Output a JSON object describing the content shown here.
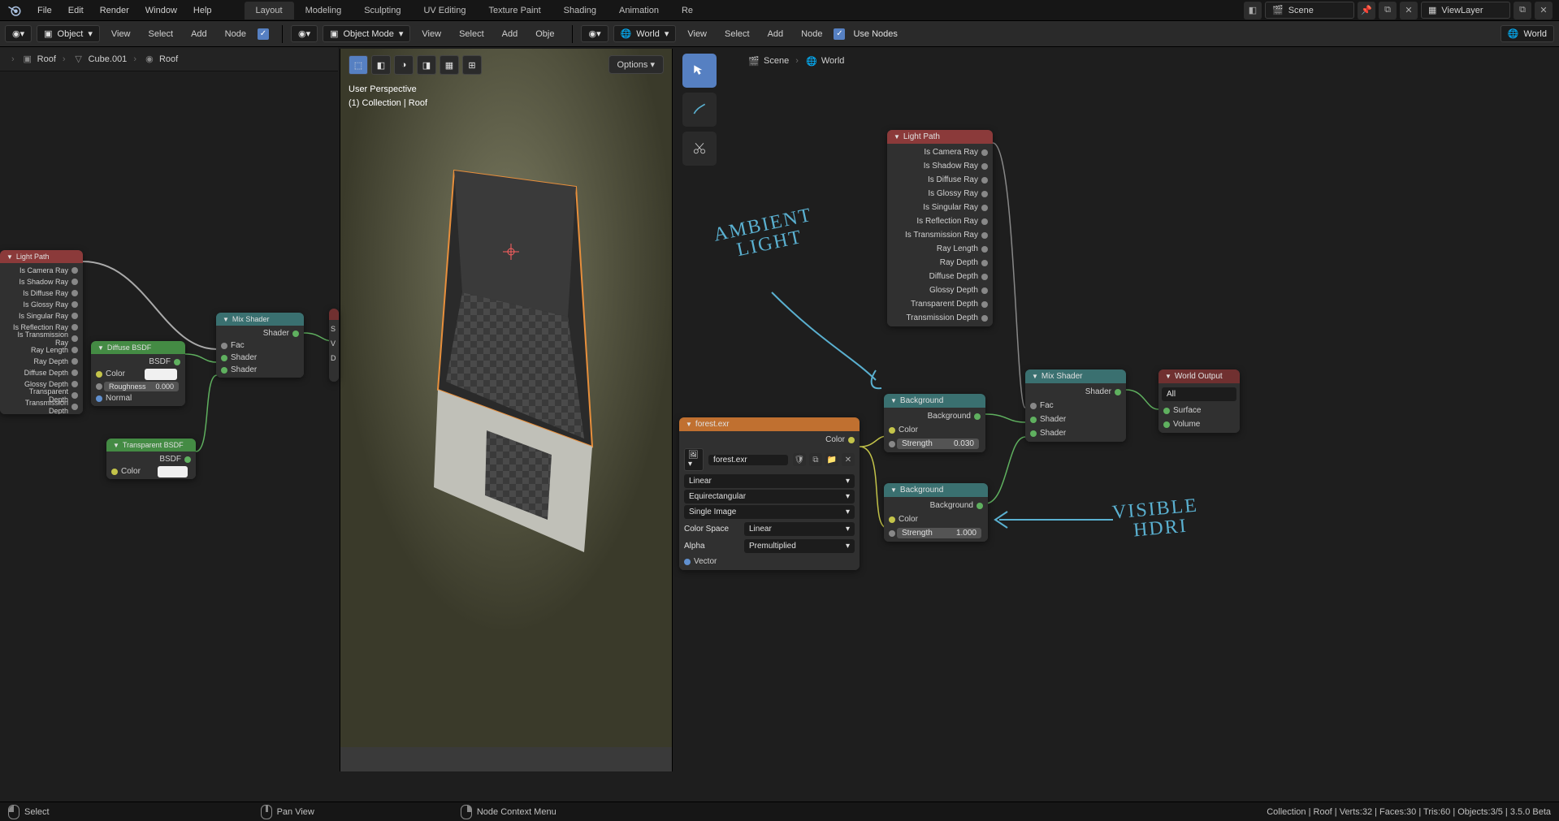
{
  "menubar": {
    "items": [
      "File",
      "Edit",
      "Render",
      "Window",
      "Help"
    ]
  },
  "workspaces": {
    "tabs": [
      "Layout",
      "Modeling",
      "Sculpting",
      "UV Editing",
      "Texture Paint",
      "Shading",
      "Animation",
      "Re"
    ],
    "active": 0
  },
  "topright": {
    "scene": "Scene",
    "viewlayer": "ViewLayer"
  },
  "left_subheader": {
    "type_label": "Object",
    "menus": [
      "View",
      "Select",
      "Add",
      "Node"
    ]
  },
  "center_subheader": {
    "mode_label": "Object Mode",
    "menus": [
      "View",
      "Select",
      "Add",
      "Obje"
    ]
  },
  "right_subheader": {
    "world_label": "World",
    "menus": [
      "View",
      "Select",
      "Add",
      "Node"
    ],
    "use_nodes": "Use Nodes",
    "slot": "World"
  },
  "breadcrumb_left": {
    "items": [
      "Roof",
      "Cube.001",
      "Roof"
    ]
  },
  "breadcrumb_right": {
    "items": [
      "Scene",
      "World"
    ]
  },
  "viewport": {
    "overlay_line1": "User Perspective",
    "overlay_line2": "(1) Collection | Roof",
    "options": "Options"
  },
  "nodes": {
    "light_path": {
      "title": "Light Path",
      "outputs": [
        "Is Camera Ray",
        "Is Shadow Ray",
        "Is Diffuse Ray",
        "Is Glossy Ray",
        "Is Singular Ray",
        "Is Reflection Ray",
        "Is Transmission Ray",
        "Ray Length",
        "Ray Depth",
        "Diffuse Depth",
        "Glossy Depth",
        "Transparent Depth",
        "Transmission Depth"
      ]
    },
    "diffuse_bsdf": {
      "title": "Diffuse BSDF",
      "bsdf": "BSDF",
      "color": "Color",
      "roughness_label": "Roughness",
      "roughness_val": "0.000",
      "normal": "Normal"
    },
    "transparent_bsdf": {
      "title": "Transparent BSDF",
      "bsdf": "BSDF",
      "color": "Color"
    },
    "mix_shader": {
      "title": "Mix Shader",
      "shader_out": "Shader",
      "fac": "Fac",
      "shader1": "Shader",
      "shader2": "Shader"
    },
    "env_tex": {
      "title": "forest.exr",
      "color": "Color",
      "filename": "forest.exr",
      "interp": "Linear",
      "projection": "Equirectangular",
      "source": "Single Image",
      "colorspace_label": "Color Space",
      "colorspace_val": "Linear",
      "alpha_label": "Alpha",
      "alpha_val": "Premultiplied",
      "vector": "Vector"
    },
    "background1": {
      "title": "Background",
      "background_out": "Background",
      "color": "Color",
      "strength_label": "Strength",
      "strength_val": "0.030"
    },
    "background2": {
      "title": "Background",
      "background_out": "Background",
      "color": "Color",
      "strength_label": "Strength",
      "strength_val": "1.000"
    },
    "world_output": {
      "title": "World Output",
      "target": "All",
      "surface": "Surface",
      "volume": "Volume"
    }
  },
  "annotations": {
    "ambient": "AMBIENT LIGHT",
    "visible": "VISIBLE HDRI"
  },
  "statusbar": {
    "select": "Select",
    "pan": "Pan View",
    "context": "Node Context Menu",
    "stats": "Collection | Roof | Verts:32 | Faces:30 | Tris:60 | Objects:3/5 | 3.5.0 Beta"
  }
}
